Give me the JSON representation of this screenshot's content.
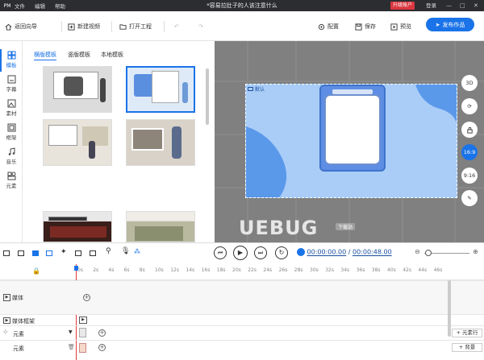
{
  "menubar": {
    "logo": "PM",
    "menus": [
      "文件",
      "编辑",
      "帮助"
    ],
    "title": "*容易拉肚子的人该注意什么",
    "upgrade": "升级账户",
    "login": "登录"
  },
  "toolbar": {
    "back": "返回向导",
    "new_video": "新建视频",
    "open_project": "打开工程",
    "config": "配置",
    "save": "保存",
    "preview": "预览",
    "publish": "发布作品"
  },
  "left_tabs": [
    "模板",
    "字幕",
    "素材",
    "框架",
    "音乐",
    "元素"
  ],
  "template_tabs": [
    "横版模板",
    "竖版模板",
    "本地模板"
  ],
  "canvas": {
    "layer_label": "默认",
    "watermark": "UEBUG",
    "watermark_sub": "下载站"
  },
  "right_tools": [
    "3D",
    "",
    "",
    "16:9",
    "9:16",
    ""
  ],
  "player": {
    "current": "00:00:00.00",
    "separator": "/",
    "total": "00:00:48.00"
  },
  "timeline": {
    "ticks": [
      "0s",
      "2s",
      "4s",
      "6s",
      "8s",
      "10s",
      "12s",
      "14s",
      "16s",
      "18s",
      "20s",
      "22s",
      "24s",
      "26s",
      "28s",
      "30s",
      "32s",
      "34s",
      "36s",
      "38s",
      "40s",
      "42s",
      "44s",
      "46s"
    ],
    "tracks": [
      "媒体",
      "媒体框架",
      "元素",
      "元素"
    ],
    "add_element_row": "+ 元素行",
    "add_background": "+ 背景"
  },
  "colors": {
    "accent": "#1a73e8",
    "canvas_bg": "#808080",
    "stage_blue": "#7fb2f0"
  }
}
